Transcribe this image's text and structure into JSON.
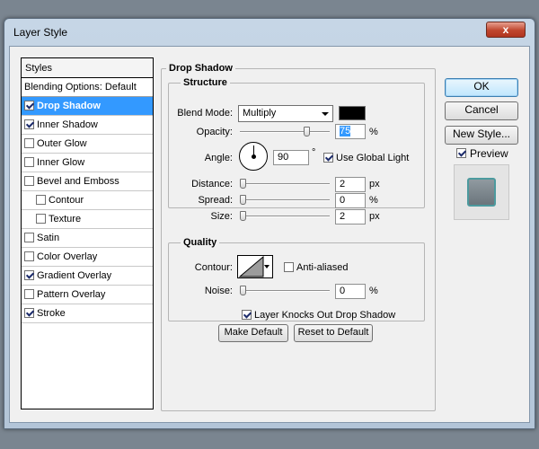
{
  "window": {
    "title": "Layer Style",
    "close_label": "x"
  },
  "styles_list": {
    "header": "Styles",
    "blending_options": "Blending Options: Default",
    "items": [
      {
        "label": "Drop Shadow",
        "checked": true,
        "selected": true,
        "sub": false
      },
      {
        "label": "Inner Shadow",
        "checked": true,
        "selected": false,
        "sub": false
      },
      {
        "label": "Outer Glow",
        "checked": false,
        "selected": false,
        "sub": false
      },
      {
        "label": "Inner Glow",
        "checked": false,
        "selected": false,
        "sub": false
      },
      {
        "label": "Bevel and Emboss",
        "checked": false,
        "selected": false,
        "sub": false
      },
      {
        "label": "Contour",
        "checked": false,
        "selected": false,
        "sub": true
      },
      {
        "label": "Texture",
        "checked": false,
        "selected": false,
        "sub": true
      },
      {
        "label": "Satin",
        "checked": false,
        "selected": false,
        "sub": false
      },
      {
        "label": "Color Overlay",
        "checked": false,
        "selected": false,
        "sub": false
      },
      {
        "label": "Gradient Overlay",
        "checked": true,
        "selected": false,
        "sub": false
      },
      {
        "label": "Pattern Overlay",
        "checked": false,
        "selected": false,
        "sub": false
      },
      {
        "label": "Stroke",
        "checked": true,
        "selected": false,
        "sub": false
      }
    ]
  },
  "drop_shadow": {
    "group_title": "Drop Shadow",
    "structure": {
      "title": "Structure",
      "blend_mode_label": "Blend Mode:",
      "blend_mode_value": "Multiply",
      "shadow_color": "#000000",
      "opacity_label": "Opacity:",
      "opacity_value": "75",
      "opacity_fraction": 0.75,
      "opacity_unit": "%",
      "angle_label": "Angle:",
      "angle_value": "90",
      "angle_unit": "°",
      "use_global_light_label": "Use Global Light",
      "use_global_light": true,
      "distance_label": "Distance:",
      "distance_value": "2",
      "distance_unit": "px",
      "spread_label": "Spread:",
      "spread_value": "0",
      "spread_unit": "%",
      "size_label": "Size:",
      "size_value": "2",
      "size_unit": "px"
    },
    "quality": {
      "title": "Quality",
      "contour_label": "Contour:",
      "anti_aliased_label": "Anti-aliased",
      "anti_aliased": false,
      "noise_label": "Noise:",
      "noise_value": "0",
      "noise_unit": "%"
    },
    "layer_knocks_out_label": "Layer Knocks Out Drop Shadow",
    "layer_knocks_out": true,
    "make_default_label": "Make Default",
    "reset_default_label": "Reset to Default"
  },
  "actions": {
    "ok_label": "OK",
    "cancel_label": "Cancel",
    "new_style_label": "New Style...",
    "preview_label": "Preview",
    "preview_checked": true
  }
}
